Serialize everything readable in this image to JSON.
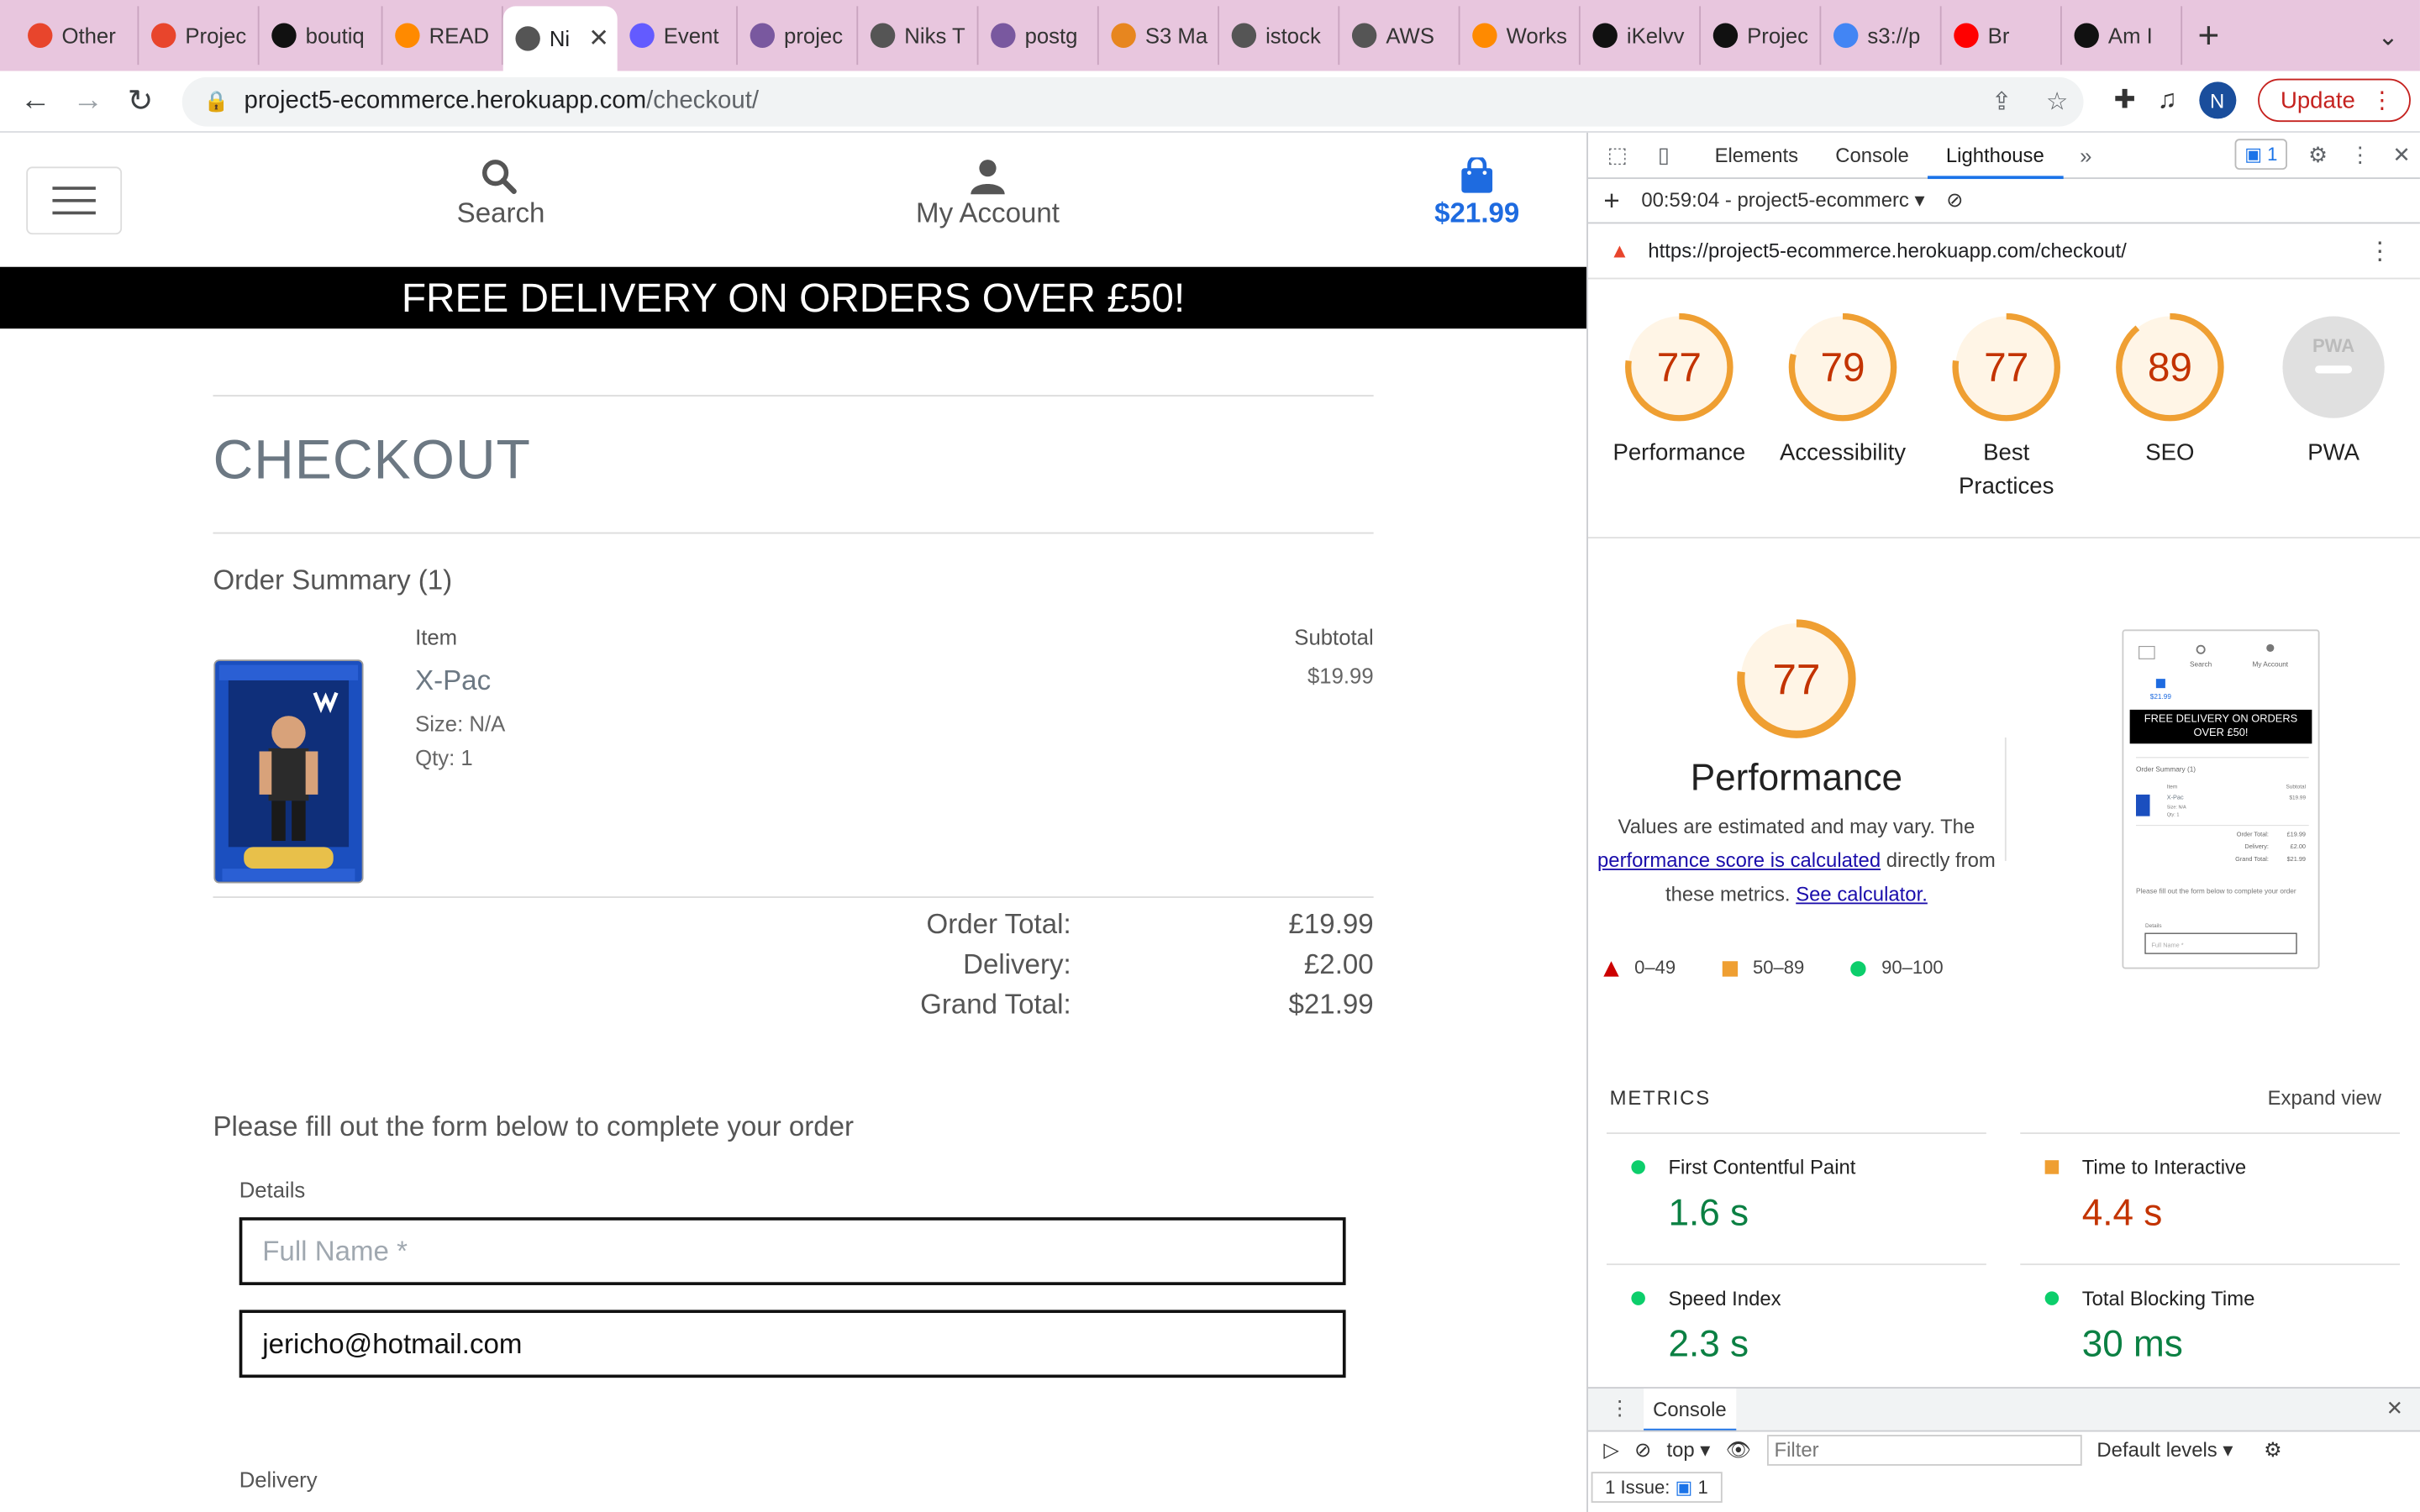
{
  "browser": {
    "tabs": [
      {
        "label": "Other",
        "icon": "opera-icon",
        "color": "#e8452c"
      },
      {
        "label": "Projec",
        "icon": "opera-icon",
        "color": "#e8452c"
      },
      {
        "label": "boutiq",
        "icon": "github-icon",
        "color": "#111"
      },
      {
        "label": "READ",
        "icon": "gitpod-icon",
        "color": "#ff8a00"
      },
      {
        "label": "Ni",
        "icon": "globe-icon",
        "color": "#555",
        "active": true
      },
      {
        "label": "Event",
        "icon": "stripe-icon",
        "color": "#635bff"
      },
      {
        "label": "projec",
        "icon": "heroku-icon",
        "color": "#79589f"
      },
      {
        "label": "Niks T",
        "icon": "globe-icon",
        "color": "#555"
      },
      {
        "label": "postg",
        "icon": "heroku-icon",
        "color": "#79589f"
      },
      {
        "label": "S3 Ma",
        "icon": "aws-icon",
        "color": "#e7861f"
      },
      {
        "label": "istock",
        "icon": "globe-icon",
        "color": "#555"
      },
      {
        "label": "AWS",
        "icon": "globe-icon",
        "color": "#555"
      },
      {
        "label": "Works",
        "icon": "gitpod-icon",
        "color": "#ff8a00"
      },
      {
        "label": "iKelvv",
        "icon": "github-icon",
        "color": "#111"
      },
      {
        "label": "Projec",
        "icon": "github-icon",
        "color": "#111"
      },
      {
        "label": "s3://p",
        "icon": "google-icon",
        "color": "#4285f4"
      },
      {
        "label": "Br",
        "icon": "youtube-icon",
        "color": "#ff0000"
      },
      {
        "label": "Am I",
        "icon": "amiresponsive-icon",
        "color": "#111"
      }
    ],
    "url_host": "project5-ecommerce.herokuapp.com",
    "url_path": "/checkout/",
    "profile_initial": "N",
    "update_label": "Update"
  },
  "site": {
    "search_label": "Search",
    "account_label": "My Account",
    "bag_total": "$21.99",
    "banner": "FREE DELIVERY ON ORDERS OVER £50!",
    "checkout_title": "CHECKOUT",
    "summary_title": "Order Summary (1)",
    "col_item": "Item",
    "col_subtotal": "Subtotal",
    "product": {
      "name": "X-Pac",
      "size": "Size: N/A",
      "qty": "Qty: 1",
      "subtotal": "$19.99"
    },
    "totals": [
      {
        "label": "Order Total:",
        "value": "£19.99"
      },
      {
        "label": "Delivery:",
        "value": "£2.00"
      },
      {
        "label": "Grand Total:",
        "value": "$21.99"
      }
    ],
    "form_intro": "Please fill out the form below to complete your order",
    "details_legend": "Details",
    "full_name_placeholder": "Full Name *",
    "email_value": "jericho@hotmail.com",
    "delivery_legend": "Delivery"
  },
  "devtools": {
    "tabs": [
      "Elements",
      "Console",
      "Lighthouse"
    ],
    "active_tab": "Lighthouse",
    "issue_count": "1",
    "report_label": "00:59:04 - project5-ecommerc",
    "report_url": "https://project5-ecommerce.herokuapp.com/checkout/",
    "gauges": [
      {
        "label": "Performance",
        "score": 77
      },
      {
        "label": "Accessibility",
        "score": 79
      },
      {
        "label": "Best Practices",
        "score": 77
      },
      {
        "label": "SEO",
        "score": 89
      },
      {
        "label": "PWA",
        "score": null
      }
    ],
    "pwa_badge": "PWA",
    "big_score": 77,
    "big_title": "Performance",
    "desc_1": "Values are estimated and may vary. The",
    "desc_link": "performance score is calculated",
    "desc_2": "directly from",
    "desc_3": "these metrics.",
    "calc_link": "See calculator.",
    "legend": [
      "0–49",
      "50–89",
      "90–100"
    ],
    "metrics_title": "METRICS",
    "expand_label": "Expand view",
    "metrics": [
      {
        "name": "First Contentful Paint",
        "value": "1.6 s",
        "status": "good"
      },
      {
        "name": "Time to Interactive",
        "value": "4.4 s",
        "status": "average"
      },
      {
        "name": "Speed Index",
        "value": "2.3 s",
        "status": "good"
      },
      {
        "name": "Total Blocking Time",
        "value": "30 ms",
        "status": "good"
      }
    ],
    "console_title": "Console",
    "context": "top",
    "filter_placeholder": "Filter",
    "levels": "Default levels",
    "issues_label": "1 Issue:",
    "issues_count": "1"
  },
  "colors": {
    "tab_strip": "#e8c6de",
    "gauge_orange": "#ef9f32",
    "gauge_orange_text": "#c33300",
    "gauge_green": "#0c9d58",
    "metric_green_text": "#0b8043",
    "bag_blue": "#1e6be0"
  },
  "thumbnail": {
    "search": "Search",
    "account": "My Account",
    "total": "$21.99",
    "banner": "FREE DELIVERY ON ORDERS OVER £50!",
    "summary": "Order Summary (1)",
    "item": "Item",
    "subtotal": "Subtotal",
    "name": "X-Pac",
    "price": "$19.99",
    "size": "Size: N/A",
    "qty": "Qty: 1",
    "order_total": "Order Total:",
    "order_total_val": "£19.99",
    "delivery": "Delivery:",
    "delivery_val": "£2.00",
    "grand_total": "Grand Total:",
    "grand_total_val": "$21.99",
    "note": "Please fill out the form below to complete your order",
    "details": "Details",
    "full_name": "Full Name *"
  }
}
